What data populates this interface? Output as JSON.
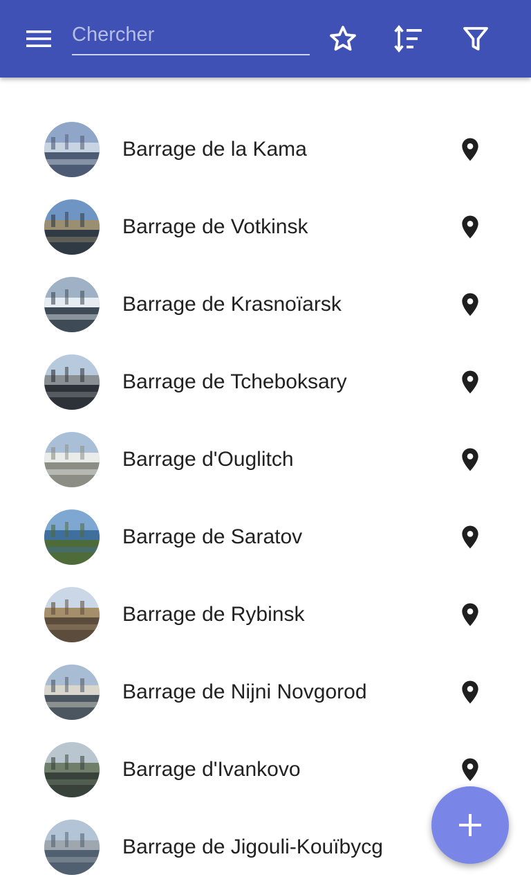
{
  "appbar": {
    "search_placeholder": "Chercher",
    "search_value": "",
    "icons": {
      "menu": "menu-icon",
      "favorite": "star-outline-icon",
      "sort": "sort-icon",
      "filter": "filter-icon"
    },
    "background": "#3f51b5"
  },
  "list": {
    "items": [
      {
        "title": "Barrage de la Kama",
        "thumb_colors": [
          "#8fa6c8",
          "#c9d4e3",
          "#4d5a73"
        ],
        "pin_icon": "map-marker-icon"
      },
      {
        "title": "Barrage de Votkinsk",
        "thumb_colors": [
          "#6f95c4",
          "#9a8f70",
          "#2f3a44"
        ],
        "pin_icon": "map-marker-icon"
      },
      {
        "title": "Barrage de Krasnoïarsk",
        "thumb_colors": [
          "#9fb1c4",
          "#e6ecf2",
          "#3e4a56"
        ],
        "pin_icon": "map-marker-icon"
      },
      {
        "title": "Barrage de Tcheboksary",
        "thumb_colors": [
          "#b7c9dc",
          "#8a8f94",
          "#2d3238"
        ],
        "pin_icon": "map-marker-icon"
      },
      {
        "title": "Barrage d'Ouglitch",
        "thumb_colors": [
          "#a9bfd8",
          "#e9ece8",
          "#8c8e86"
        ],
        "pin_icon": "map-marker-icon"
      },
      {
        "title": "Barrage de Saratov",
        "thumb_colors": [
          "#7ea7d2",
          "#3f6f9c",
          "#4e6b3a"
        ],
        "pin_icon": "map-marker-icon"
      },
      {
        "title": "Barrage de Rybinsk",
        "thumb_colors": [
          "#c9d7e6",
          "#a58e6a",
          "#5b4c3c"
        ],
        "pin_icon": "map-marker-icon"
      },
      {
        "title": "Barrage de Nijni Novgorod",
        "thumb_colors": [
          "#a8bdd3",
          "#d9d6cc",
          "#4c5660"
        ],
        "pin_icon": "map-marker-icon"
      },
      {
        "title": "Barrage d'Ivankovo",
        "thumb_colors": [
          "#b9c6cf",
          "#6f7f6a",
          "#38423a"
        ],
        "pin_icon": "map-marker-icon"
      },
      {
        "title": "Barrage de Jigouli-Kouïbycg",
        "thumb_colors": [
          "#b2c4d6",
          "#9da7ad",
          "#506070"
        ],
        "pin_icon": "map-marker-icon"
      }
    ]
  },
  "fab": {
    "icon": "plus-icon",
    "color": "#7986e8"
  }
}
